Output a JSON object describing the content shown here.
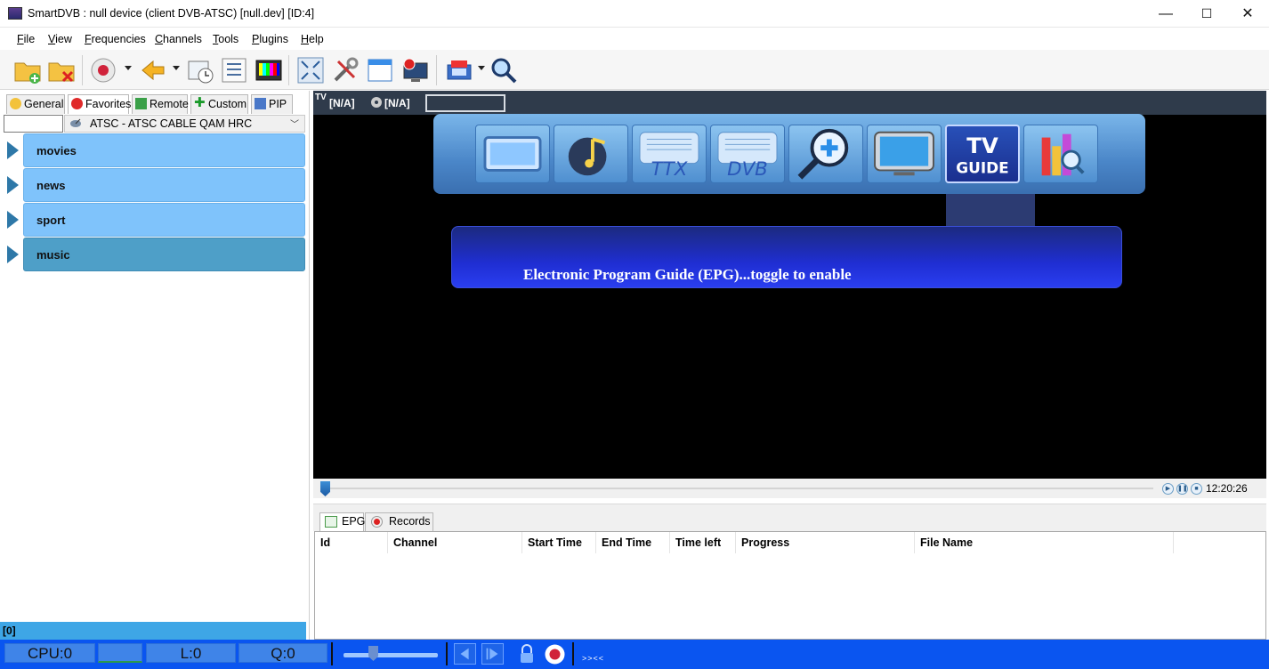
{
  "window": {
    "title": "SmartDVB : null device (client DVB-ATSC) [null.dev]  [ID:4]",
    "controls": [
      "—",
      "☐",
      "✕"
    ]
  },
  "menu": {
    "file": "File",
    "view": "View",
    "frequencies": "Frequencies",
    "channels": "Channels",
    "tools": "Tools",
    "plugins": "Plugins",
    "help": "Help"
  },
  "left": {
    "tabs": [
      "General",
      "Favorites",
      "Remote",
      "Custom",
      "PIP"
    ],
    "source_value": "ATSC - ATSC CABLE QAM HRC",
    "categories": [
      {
        "label": "movies"
      },
      {
        "label": "news"
      },
      {
        "label": "sport"
      },
      {
        "label": "music"
      }
    ],
    "status": "[0]"
  },
  "video": {
    "signal1": "[N/A]",
    "signal2": "[N/A]",
    "tv_label": "TV",
    "epg_message": "Electronic Program Guide (EPG)...toggle to enable",
    "tiles": [
      "video-icon",
      "music-icon",
      "ttx-icon",
      "dvb-icon",
      "zoom-icon",
      "tv-icon",
      "tv-guide-icon",
      "stats-icon"
    ],
    "ttx_text": "TTX",
    "dvb_text": "DVB",
    "guide_tv": "TV",
    "guide_word": "GUIDE"
  },
  "playback": {
    "time": "12:20:26",
    "progress_fraction": 0.0
  },
  "bottom": {
    "tabs": [
      "EPG",
      "Records"
    ],
    "columns": [
      "Id",
      "Channel",
      "Start Time",
      "End Time",
      "Time left",
      "Progress",
      "File Name"
    ]
  },
  "statusbar": {
    "cpu": "CPU:0",
    "l": "L:0",
    "q": "Q:0",
    "ticker": ">><<"
  },
  "colors": {
    "accent_blue": "#0a55f0",
    "category_blue": "#7fc3fb",
    "category_selected": "#4e9fc8"
  }
}
